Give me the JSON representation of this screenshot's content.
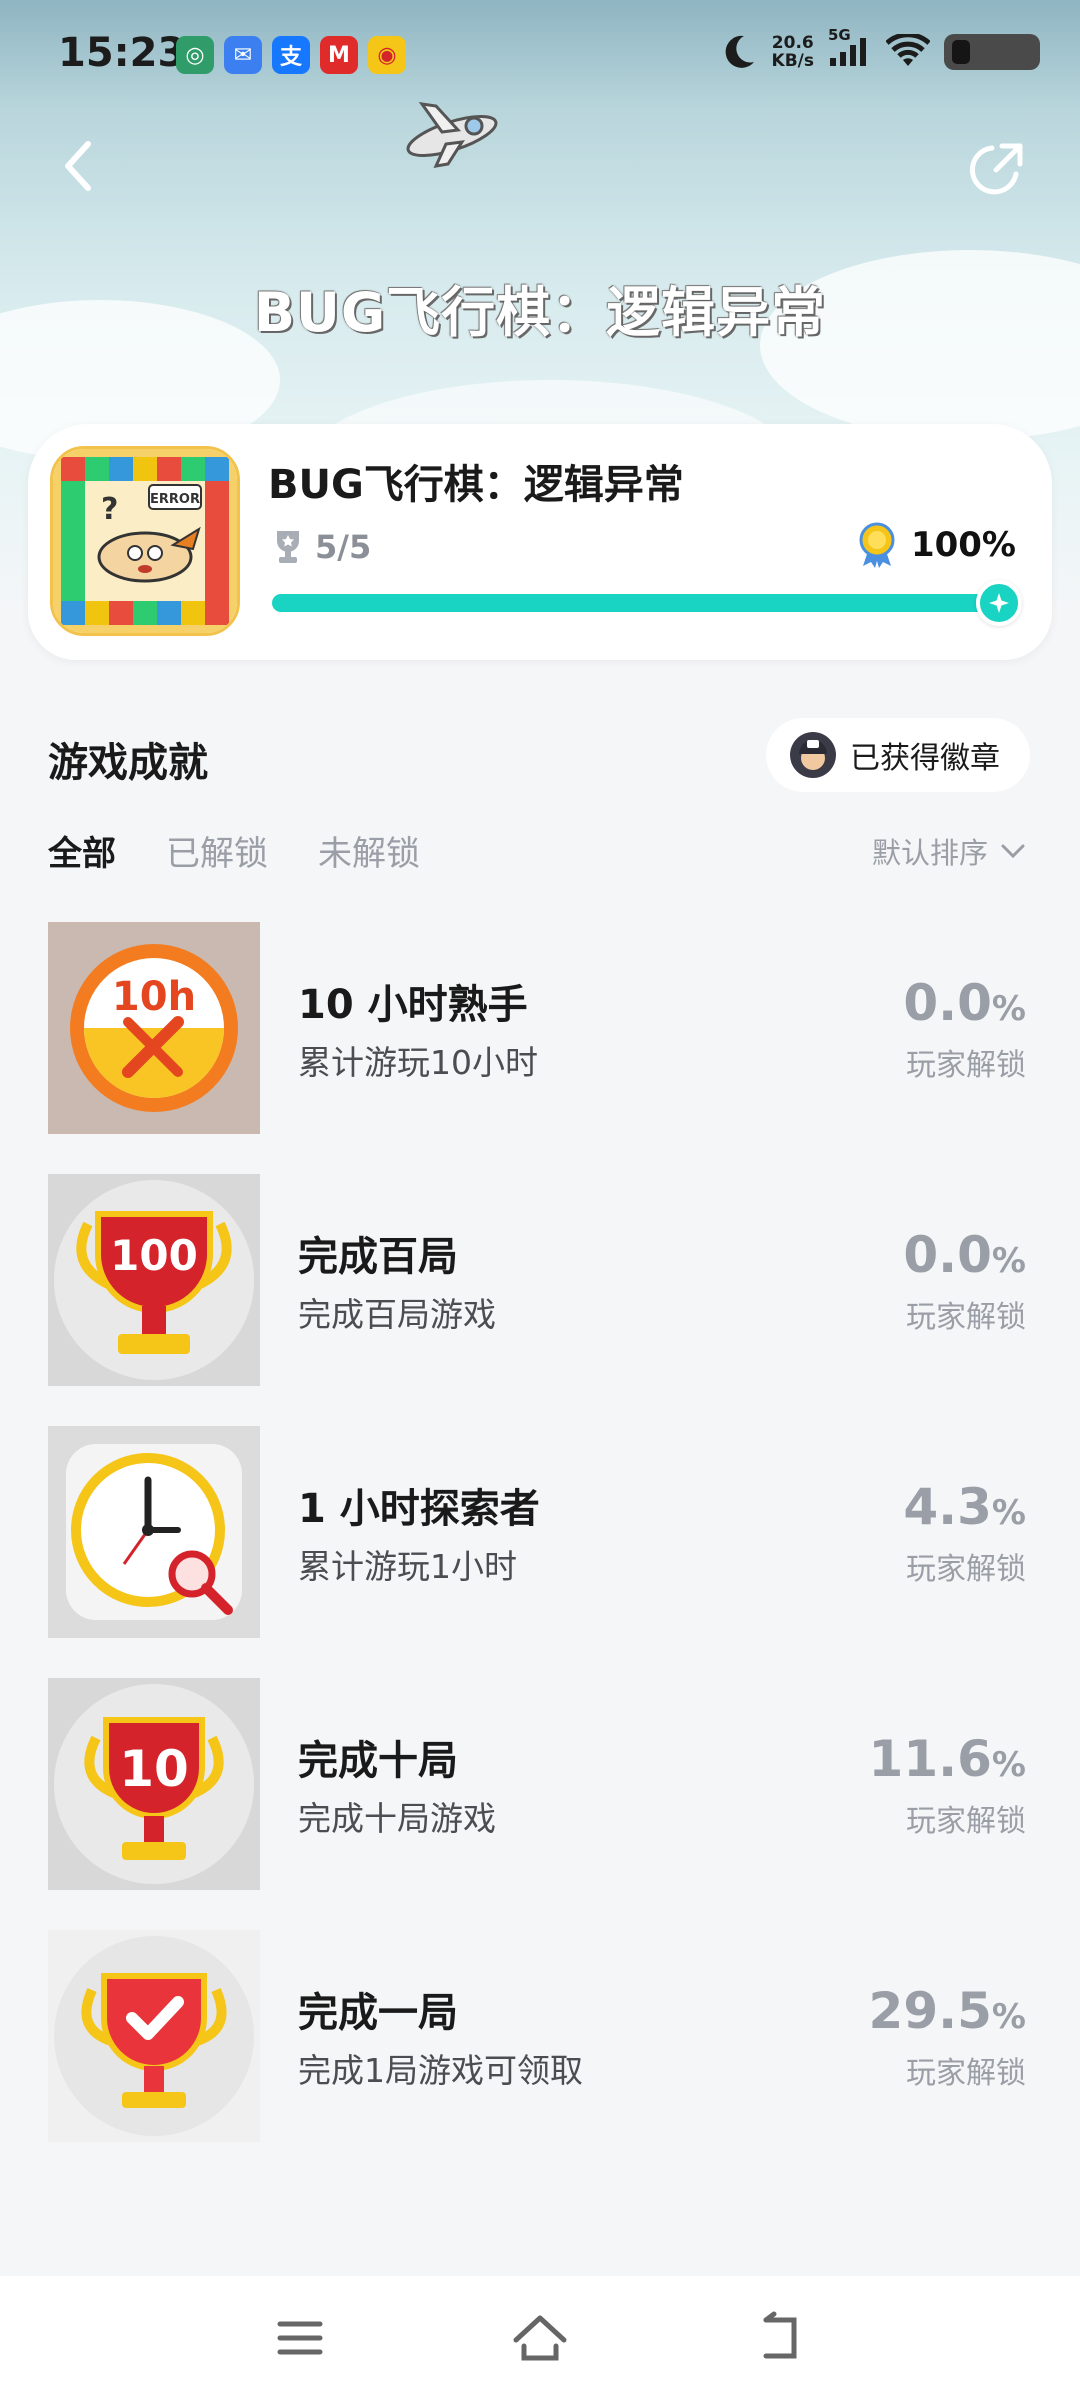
{
  "status_bar": {
    "time": "15:23",
    "net_speed_value": "20.6",
    "net_speed_unit": "KB/s",
    "network_type": "5G",
    "app_icons": [
      "mobile-icon",
      "message-icon",
      "alipay-icon",
      "metro-icon",
      "weibo-icon"
    ]
  },
  "header": {
    "title": "BUG飞行棋：逻辑异常"
  },
  "game_card": {
    "name": "BUG飞行棋：逻辑异常",
    "trophy_count": "5/5",
    "completion_percent": "100%",
    "progress": 1.0
  },
  "achievements_section": {
    "title": "游戏成就",
    "badge_button_label": "已获得徽章"
  },
  "tabs": [
    {
      "label": "全部",
      "active": true
    },
    {
      "label": "已解锁",
      "active": false
    },
    {
      "label": "未解锁",
      "active": false
    }
  ],
  "sort": {
    "label": "默认排序"
  },
  "achievements": [
    {
      "name": "10 小时熟手",
      "desc": "累计游玩10小时",
      "percent": "0.0",
      "unit": "%",
      "sub": "玩家解锁",
      "icon": "ten-hours-badge-icon",
      "icon_text": "10h"
    },
    {
      "name": "完成百局",
      "desc": "完成百局游戏",
      "percent": "0.0",
      "unit": "%",
      "sub": "玩家解锁",
      "icon": "trophy-100-icon",
      "icon_text": "100"
    },
    {
      "name": "1 小时探索者",
      "desc": "累计游玩1小时",
      "percent": "4.3",
      "unit": "%",
      "sub": "玩家解锁",
      "icon": "clock-magnifier-icon"
    },
    {
      "name": "完成十局",
      "desc": "完成十局游戏",
      "percent": "11.6",
      "unit": "%",
      "sub": "玩家解锁",
      "icon": "trophy-10-icon",
      "icon_text": "10"
    },
    {
      "name": "完成一局",
      "desc": "完成1局游戏可领取",
      "percent": "29.5",
      "unit": "%",
      "sub": "玩家解锁",
      "icon": "trophy-check-icon"
    }
  ],
  "colors": {
    "accent": "#19d3c3",
    "trophy_red": "#d4232b",
    "trophy_gold": "#f5c518"
  }
}
